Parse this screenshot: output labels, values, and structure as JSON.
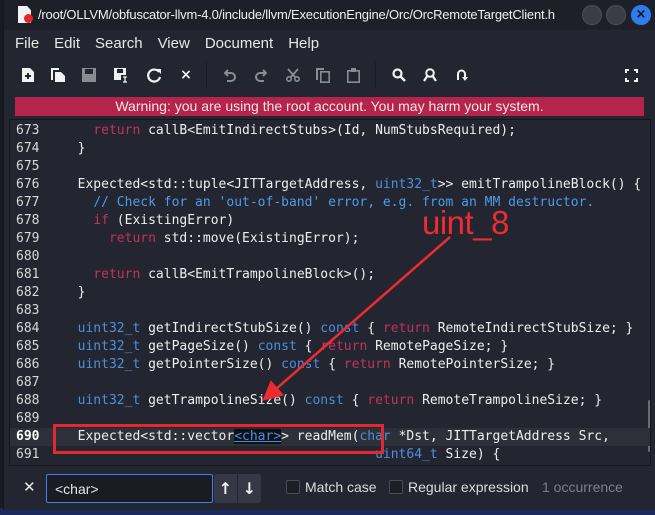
{
  "window": {
    "title": "/root/OLLVM/obfuscator-llvm-4.0/include/llvm/ExecutionEngine/Orc/OrcRemoteTargetClient.h",
    "controls": {
      "minimize": "minimize-button",
      "maximize": "maximize-button",
      "close": "×"
    }
  },
  "menu": [
    "File",
    "Edit",
    "Search",
    "View",
    "Document",
    "Help"
  ],
  "toolbar": {
    "new": "+",
    "open": "❐",
    "save": "▣",
    "save_as": "▣",
    "reload": "↻",
    "close": "×",
    "undo": "↶",
    "redo": "↷",
    "cut": "✂",
    "copy": "⧉",
    "paste": "📋",
    "find": "⌕",
    "replace": "⚒",
    "goto": "↷",
    "fullscreen": "⛶"
  },
  "warning": "Warning: you are using the root account. You may harm your system.",
  "editor": {
    "lines": [
      {
        "num": "673",
        "html": "    <span class=\"kw\">return</span> callB&lt;EmitIndirectStubs&gt;(Id, NumStubsRequired);"
      },
      {
        "num": "674",
        "html": "  }"
      },
      {
        "num": "675",
        "html": ""
      },
      {
        "num": "676",
        "html": "  Expected&lt;std::tuple&lt;JITTargetAddress, <span class=\"ty\">uint32_t</span>&gt;&gt; emitTrampolineBlock() {"
      },
      {
        "num": "677",
        "html": "    <span class=\"cm\">// Check for an 'out-of-band' error, e.g. from an MM destructor.</span>"
      },
      {
        "num": "678",
        "html": "    <span class=\"kw\">if</span> (ExistingError)"
      },
      {
        "num": "679",
        "html": "      <span class=\"kw\">return</span> std::move(ExistingError);"
      },
      {
        "num": "680",
        "html": ""
      },
      {
        "num": "681",
        "html": "    <span class=\"kw\">return</span> callB&lt;EmitTrampolineBlock&gt;();"
      },
      {
        "num": "682",
        "html": "  }"
      },
      {
        "num": "683",
        "html": ""
      },
      {
        "num": "684",
        "html": "  <span class=\"ty\">uint32_t</span> getIndirectStubSize() <span class=\"ty\">const</span> { <span class=\"kw\">return</span> RemoteIndirectStubSize; }"
      },
      {
        "num": "685",
        "html": "  <span class=\"ty\">uint32_t</span> getPageSize() <span class=\"ty\">const</span> { <span class=\"kw\">return</span> RemotePageSize; }"
      },
      {
        "num": "686",
        "html": "  <span class=\"ty\">uint32_t</span> getPointerSize() <span class=\"ty\">const</span> { <span class=\"kw\">return</span> RemotePointerSize; }"
      },
      {
        "num": "687",
        "html": ""
      },
      {
        "num": "688",
        "html": "  <span class=\"ty\">uint32_t</span> getTrampolineSize() <span class=\"ty\">const</span> { <span class=\"kw\">return</span> RemoteTrampolineSize; }"
      },
      {
        "num": "689",
        "html": ""
      },
      {
        "num": "690",
        "html": "  Expected&lt;std::vector<span class=\"hl\">&lt;char&gt;</span>&gt; readMem(<span class=\"ty\">char</span> *Dst, JITTargetAddress Src,",
        "current": true
      },
      {
        "num": "691",
        "html": "                                        <span class=\"ty\">uint64_t</span> Size) {"
      }
    ]
  },
  "annotation": {
    "label": "uint_8"
  },
  "find": {
    "query": "<char>",
    "up": "↑",
    "down": "↓",
    "match_case_label": "Match case",
    "match_case_checked": false,
    "regex_label": "Regular expression",
    "regex_checked": false,
    "status": "1 occurrence"
  }
}
